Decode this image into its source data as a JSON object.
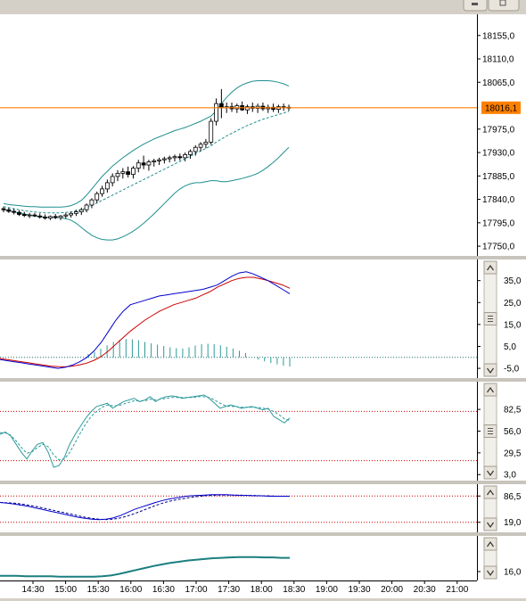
{
  "title_bar": {
    "minimize_icon": "minimize-icon",
    "restore_icon": "restore-icon"
  },
  "colors": {
    "background": "#ffffff",
    "frame": "#d4d0c8",
    "candle": "#000000",
    "bollinger": "#1f8f8f",
    "price_line": "#ff8000",
    "macd": "#0000cc",
    "signal": "#cc0000",
    "histogram": "#2e9a9a",
    "stochastic": "#2e9a9a",
    "level_line": "#cc0000",
    "dotted_zero": "#1f6f6f"
  },
  "scroll_icons": {
    "up": "scroll-up-icon",
    "down": "scroll-down-icon",
    "grip": "grip-icon"
  },
  "chart_data": [
    {
      "type": "candlestick",
      "panel": "price",
      "y_ticks": [
        "18155,0",
        "18110,0",
        "18065,0",
        "17975,0",
        "17930,0",
        "17885,0",
        "17840,0",
        "17795,0",
        "17750,0"
      ],
      "ylim": [
        17745,
        18182
      ],
      "current_price_label": "18016,1",
      "current_price": 18016.1,
      "x_ticks": [
        "14:30",
        "15:00",
        "15:30",
        "16:00",
        "16:30",
        "17:00",
        "17:30",
        "18:00",
        "18:30",
        "19:00",
        "19:30",
        "20:00",
        "20:30",
        "21:00"
      ],
      "candles": [
        [
          17822,
          17826,
          17815,
          17820
        ],
        [
          17820,
          17824,
          17814,
          17817
        ],
        [
          17817,
          17822,
          17811,
          17815
        ],
        [
          17815,
          17819,
          17808,
          17811
        ],
        [
          17811,
          17816,
          17806,
          17809
        ],
        [
          17809,
          17814,
          17804,
          17810
        ],
        [
          17810,
          17814,
          17806,
          17808
        ],
        [
          17808,
          17813,
          17803,
          17806
        ],
        [
          17806,
          17811,
          17801,
          17804
        ],
        [
          17804,
          17809,
          17800,
          17807
        ],
        [
          17807,
          17812,
          17802,
          17805
        ],
        [
          17805,
          17810,
          17800,
          17808
        ],
        [
          17808,
          17814,
          17803,
          17810
        ],
        [
          17810,
          17816,
          17805,
          17813
        ],
        [
          17813,
          17820,
          17808,
          17816
        ],
        [
          17816,
          17824,
          17810,
          17820
        ],
        [
          17820,
          17832,
          17815,
          17829
        ],
        [
          17829,
          17842,
          17823,
          17839
        ],
        [
          17839,
          17855,
          17833,
          17851
        ],
        [
          17851,
          17866,
          17845,
          17860
        ],
        [
          17860,
          17878,
          17853,
          17872
        ],
        [
          17872,
          17890,
          17865,
          17884
        ],
        [
          17884,
          17896,
          17875,
          17890
        ],
        [
          17890,
          17900,
          17880,
          17893
        ],
        [
          17893,
          17903,
          17882,
          17888
        ],
        [
          17888,
          17904,
          17880,
          17900
        ],
        [
          17900,
          17916,
          17892,
          17910
        ],
        [
          17910,
          17924,
          17898,
          17906
        ],
        [
          17906,
          17916,
          17895,
          17912
        ],
        [
          17912,
          17918,
          17903,
          17914
        ],
        [
          17914,
          17920,
          17906,
          17916
        ],
        [
          17916,
          17922,
          17909,
          17918
        ],
        [
          17918,
          17924,
          17911,
          17920
        ],
        [
          17920,
          17926,
          17913,
          17922
        ],
        [
          17922,
          17928,
          17915,
          17920
        ],
        [
          17920,
          17930,
          17913,
          17926
        ],
        [
          17926,
          17936,
          17918,
          17932
        ],
        [
          17932,
          17944,
          17924,
          17940
        ],
        [
          17940,
          17950,
          17932,
          17946
        ],
        [
          17946,
          17956,
          17938,
          17950
        ],
        [
          17950,
          17996,
          17945,
          17990
        ],
        [
          17990,
          18034,
          17982,
          18024
        ],
        [
          18024,
          18052,
          17996,
          18016
        ],
        [
          18016,
          18026,
          18006,
          18018
        ],
        [
          18018,
          18026,
          18008,
          18014
        ],
        [
          18014,
          18024,
          18006,
          18020
        ],
        [
          18020,
          18028,
          18010,
          18012
        ],
        [
          18012,
          18022,
          18004,
          18018
        ],
        [
          18018,
          18026,
          18008,
          18015
        ],
        [
          18015,
          18024,
          18006,
          18019
        ],
        [
          18019,
          18026,
          18010,
          18014
        ],
        [
          18014,
          18022,
          18006,
          18017
        ],
        [
          18017,
          18024,
          18008,
          18013
        ],
        [
          18013,
          18022,
          18006,
          18018
        ],
        [
          18018,
          18024,
          18010,
          18016
        ],
        [
          18016,
          18022,
          18010,
          18017
        ]
      ],
      "bb_middle": [
        17826,
        17824,
        17822,
        17820,
        17818,
        17817,
        17816,
        17815,
        17814,
        17814,
        17814,
        17814,
        17815,
        17816,
        17818,
        17820,
        17824,
        17828,
        17833,
        17838,
        17843,
        17848,
        17853,
        17858,
        17863,
        17868,
        17873,
        17878,
        17883,
        17888,
        17893,
        17898,
        17903,
        17908,
        17913,
        17918,
        17923,
        17928,
        17933,
        17938,
        17943,
        17950,
        17956,
        17962,
        17967,
        17972,
        17977,
        17982,
        17986,
        17990,
        17994,
        17997,
        18000,
        18003,
        18006,
        18009
      ],
      "bb_upper": [
        17832,
        17830,
        17829,
        17828,
        17827,
        17826,
        17826,
        17825,
        17825,
        17825,
        17825,
        17825,
        17826,
        17828,
        17832,
        17838,
        17848,
        17860,
        17872,
        17884,
        17894,
        17904,
        17912,
        17920,
        17927,
        17934,
        17940,
        17946,
        17951,
        17956,
        17960,
        17964,
        17968,
        17972,
        17975,
        17978,
        17982,
        17986,
        17990,
        17995,
        18000,
        18010,
        18024,
        18036,
        18046,
        18054,
        18060,
        18064,
        18067,
        18068,
        18068,
        18068,
        18067,
        18065,
        18062,
        18058
      ],
      "bb_lower": [
        17820,
        17818,
        17816,
        17814,
        17812,
        17810,
        17808,
        17807,
        17806,
        17805,
        17805,
        17805,
        17803,
        17800,
        17794,
        17786,
        17778,
        17771,
        17766,
        17763,
        17762,
        17762,
        17764,
        17768,
        17773,
        17779,
        17786,
        17794,
        17803,
        17812,
        17822,
        17832,
        17842,
        17852,
        17860,
        17866,
        17870,
        17872,
        17872,
        17874,
        17876,
        17876,
        17874,
        17874,
        17876,
        17878,
        17880,
        17883,
        17886,
        17890,
        17896,
        17903,
        17911,
        17920,
        17930,
        17940
      ]
    },
    {
      "type": "line",
      "panel": "macd",
      "y_ticks": [
        "35,0",
        "25,0",
        "15,0",
        "5,0",
        "-5,0"
      ],
      "ylim": [
        -7,
        43
      ],
      "macd": [
        -1,
        -1.5,
        -2,
        -2.5,
        -3,
        -3.5,
        -4,
        -4.5,
        -5,
        -4.5,
        -3.5,
        -2,
        0,
        3,
        7,
        12,
        17,
        21,
        24,
        25,
        26,
        27,
        28,
        28.5,
        29,
        29.5,
        30,
        30.5,
        31,
        32,
        33,
        35,
        37,
        38.5,
        39,
        38,
        36.5,
        35,
        33,
        31,
        29
      ],
      "signal": [
        -0.5,
        -1,
        -1.5,
        -2,
        -2.5,
        -3,
        -3.5,
        -4,
        -4.2,
        -4.3,
        -4,
        -3.4,
        -2.6,
        -1.3,
        0.5,
        3,
        6,
        9,
        12,
        14.5,
        17,
        19,
        21,
        22.5,
        24,
        25,
        26,
        27,
        28.5,
        30,
        32,
        33.5,
        35,
        36,
        36.5,
        36.5,
        35.8,
        35,
        34,
        33,
        31.5
      ],
      "histogram": [
        0,
        0,
        0,
        0,
        0,
        0,
        0,
        0,
        0,
        0,
        0,
        0,
        0,
        0,
        1.5,
        2.5,
        4,
        5.5,
        7,
        8,
        8.3,
        8.2,
        7.8,
        7,
        6.4,
        5.8,
        5.2,
        4.6,
        4.2,
        4,
        4.6,
        5.4,
        6,
        6.2,
        6,
        5.5,
        4.8,
        4,
        3,
        2,
        0,
        -1,
        -1.8,
        -2.6,
        -3.2,
        -3.8,
        -4.2
      ]
    },
    {
      "type": "line",
      "panel": "stochastic",
      "y_ticks": [
        "82,5",
        "56,0",
        "29,5",
        "3,0"
      ],
      "ylim": [
        0,
        112
      ],
      "levels": [
        80,
        20
      ],
      "k": [
        52,
        55,
        50,
        40,
        30,
        22,
        32,
        40,
        42,
        30,
        12,
        14,
        24,
        40,
        52,
        62,
        72,
        80,
        86,
        88,
        90,
        84,
        88,
        92,
        94,
        96,
        92,
        94,
        98,
        92,
        96,
        98,
        99,
        98,
        96,
        97,
        98,
        99,
        100,
        96,
        90,
        84,
        86,
        88,
        86,
        84,
        85,
        86,
        84,
        82,
        84,
        74,
        70,
        66,
        72
      ],
      "d": [
        54,
        54,
        51,
        44,
        36,
        29,
        31,
        36,
        40,
        37,
        27,
        21,
        22,
        30,
        42,
        54,
        65,
        74,
        80,
        85,
        88,
        87,
        87,
        89,
        91,
        93,
        93,
        93,
        95,
        94,
        95,
        96,
        97,
        97,
        97,
        97,
        97,
        98,
        98,
        97,
        94,
        90,
        87,
        86,
        86,
        85,
        85,
        85,
        85,
        84,
        83,
        80,
        76,
        71,
        69
      ]
    },
    {
      "type": "line",
      "panel": "indicator4",
      "y_ticks": [
        "86,5",
        "19,0"
      ],
      "ylim": [
        0,
        110
      ],
      "levels": [
        86.5,
        19.0
      ],
      "line": [
        70,
        68,
        66,
        63,
        60,
        56,
        52,
        48,
        44,
        40,
        36,
        32,
        29,
        27,
        26,
        27,
        30,
        36,
        44,
        52,
        58,
        64,
        70,
        75,
        79,
        82,
        85,
        87,
        88,
        89,
        90,
        90,
        90,
        89,
        88,
        88,
        87,
        87,
        86,
        86,
        86,
        86
      ],
      "dashed": [
        70,
        69,
        68,
        66,
        63,
        60,
        56,
        52,
        48,
        44,
        40,
        36,
        32,
        29,
        27,
        26,
        27,
        30,
        35,
        41,
        48,
        55,
        62,
        68,
        73,
        77,
        80,
        83,
        85,
        87,
        88,
        89,
        89,
        89,
        89,
        88,
        88,
        87,
        87,
        86,
        86,
        86
      ]
    },
    {
      "type": "line",
      "panel": "indicator5",
      "y_ticks": [
        "16,0"
      ],
      "ylim": [
        0,
        100
      ],
      "line": [
        5,
        5,
        5,
        4,
        4,
        4,
        4,
        3,
        3,
        3,
        3,
        3,
        4,
        6,
        10,
        15,
        20,
        25,
        30,
        34,
        38,
        41,
        44,
        46,
        48,
        50,
        51,
        52,
        53,
        53,
        53,
        52,
        52,
        51,
        51
      ]
    }
  ]
}
